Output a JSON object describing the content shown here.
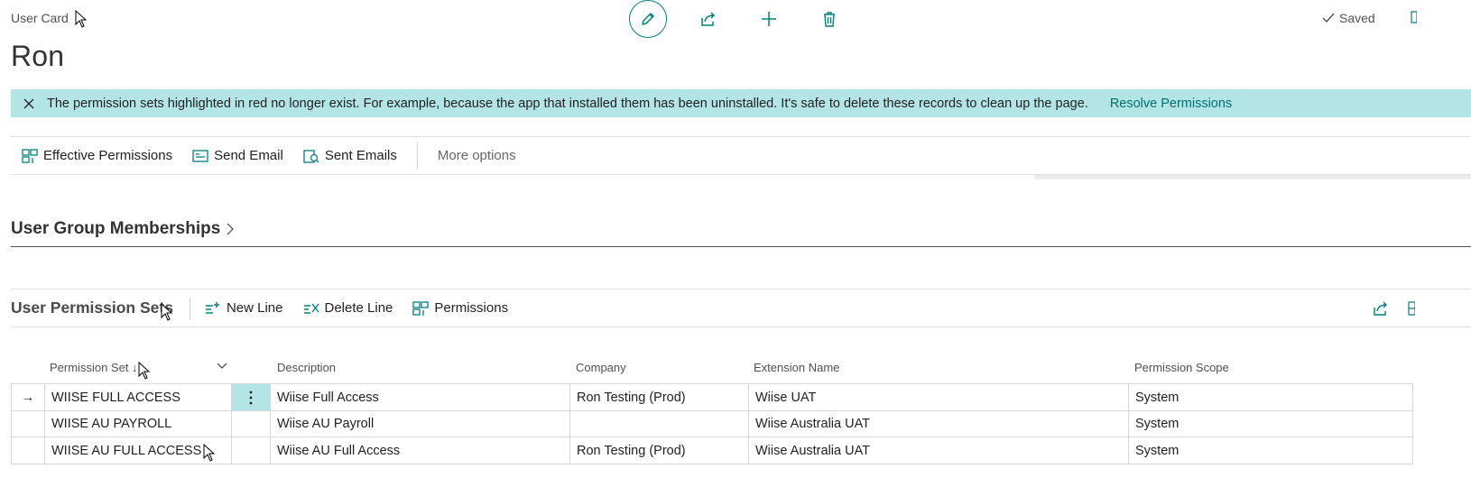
{
  "header": {
    "breadcrumb": "User Card",
    "title": "Ron",
    "saved_label": "Saved",
    "icons": [
      "pencil-icon",
      "share-icon",
      "plus-icon",
      "trash-icon",
      "checkmark-icon"
    ]
  },
  "banner": {
    "message": "The permission sets highlighted in red no longer exist. For example, because the app that installed them has been uninstalled. It's safe to delete these records to clean up the page.",
    "action": "Resolve Permissions",
    "color": "#b3e5e6"
  },
  "actions": {
    "effective_permissions": "Effective Permissions",
    "send_email": "Send Email",
    "sent_emails": "Sent Emails",
    "more_options": "More options"
  },
  "sections": {
    "user_group_memberships": "User Group Memberships",
    "user_permission_sets": "User Permission Sets"
  },
  "permission_actions": {
    "new_line": "New Line",
    "delete_line": "Delete Line",
    "permissions": "Permissions"
  },
  "table": {
    "columns": {
      "permission_set": "Permission Set",
      "sort_indicator": "↓",
      "description": "Description",
      "company": "Company",
      "extension_name": "Extension Name",
      "permission_scope": "Permission Scope"
    },
    "rows": [
      {
        "indicator": "→",
        "permission_set": "WIISE FULL ACCESS",
        "description": "Wiise Full Access",
        "company": "Ron Testing (Prod)",
        "extension_name": "Wiise UAT",
        "permission_scope": "System"
      },
      {
        "indicator": "",
        "permission_set": "WIISE AU PAYROLL",
        "description": "Wiise AU Payroll",
        "company": "",
        "extension_name": "Wiise Australia UAT",
        "permission_scope": "System"
      },
      {
        "indicator": "",
        "permission_set": "WIISE AU FULL ACCESS",
        "description": "Wiise AU Full Access",
        "company": "Ron Testing (Prod)",
        "extension_name": "Wiise Australia UAT",
        "permission_scope": "System"
      }
    ]
  },
  "colors": {
    "accent": "#00807f",
    "link": "#00706f"
  }
}
